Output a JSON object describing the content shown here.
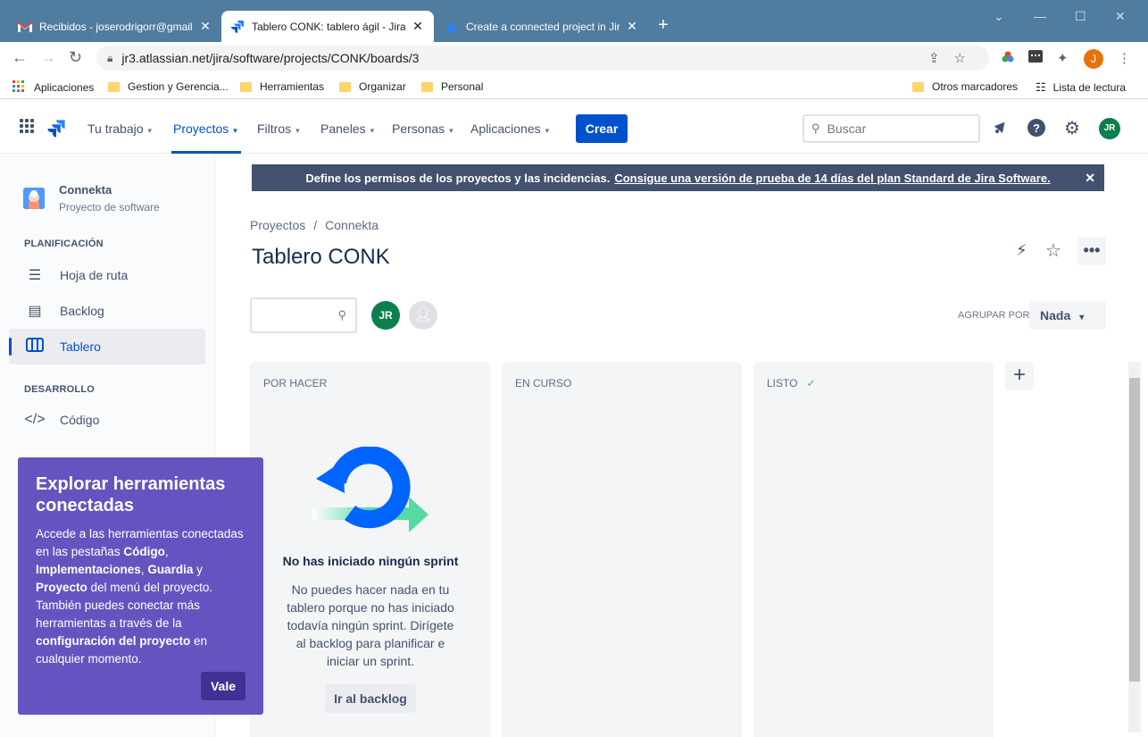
{
  "browser": {
    "tabs": [
      {
        "label": "Recibidos - joserodrigorr@gmail.",
        "close": "✕"
      },
      {
        "label": "Tablero CONK: tablero ágil - Jira",
        "close": "✕"
      },
      {
        "label": "Create a connected project in Jira",
        "close": "✕"
      }
    ],
    "new_tab": "+",
    "url": "jr3.atlassian.net/jira/software/projects/CONK/boards/3",
    "profile_initial": "J",
    "bookmarks": [
      "Aplicaciones",
      "Gestion y Gerencia...",
      "Herramientas",
      "Organizar",
      "Personal"
    ],
    "bookmarks_right": [
      "Otros marcadores",
      "Lista de lectura"
    ]
  },
  "topnav": {
    "items": [
      "Tu trabajo",
      "Proyectos",
      "Filtros",
      "Paneles",
      "Personas",
      "Aplicaciones"
    ],
    "active_index": 1,
    "create_label": "Crear",
    "search_placeholder": "Buscar",
    "avatar_initials": "JR"
  },
  "sidebar": {
    "project_name": "Connekta",
    "project_type": "Proyecto de software",
    "section_planning": "PLANIFICACIÓN",
    "planning_items": [
      "Hoja de ruta",
      "Backlog",
      "Tablero"
    ],
    "section_dev": "DESARROLLO",
    "dev_items": [
      "Código"
    ]
  },
  "banner": {
    "text": "Define los permisos de los proyectos y las incidencias.",
    "link": "Consigue una versión de prueba de 14 días del plan Standard de Jira Software.",
    "close": "✕"
  },
  "breadcrumb": {
    "items": [
      "Proyectos",
      "Connekta"
    ],
    "separator": "/"
  },
  "board": {
    "title": "Tablero CONK",
    "member_initials": "JR",
    "group_by_label": "AGRUPAR POR",
    "group_by_value": "Nada",
    "columns": [
      "POR HACER",
      "EN CURSO",
      "LISTO"
    ],
    "empty_title": "No has iniciado ningún sprint",
    "empty_text": "No puedes hacer nada en tu tablero porque no has iniciado todavía ningún sprint. Dirígete al backlog para planificar e iniciar un sprint.",
    "backlog_button": "Ir al backlog"
  },
  "spotlight": {
    "title": "Explorar herramientas conectadas",
    "body_1": "Accede a las herramientas conectadas en las pestañas ",
    "b1": "Código",
    "body_2": ", ",
    "b2": "Implementaciones",
    "body_3": ", ",
    "b3": "Guardia",
    "body_4": " y ",
    "b4": "Proyecto",
    "body_5": " del menú del proyecto. También puedes conectar más herramientas a través de la ",
    "b5": "configuración del proyecto",
    "body_6": " en cualquier momento.",
    "button": "Vale"
  },
  "colors": {
    "accent": "#0052cc",
    "spotlight": "#6554c0",
    "banner": "#42526e",
    "chrome_tabbar": "#4f7c9f"
  }
}
